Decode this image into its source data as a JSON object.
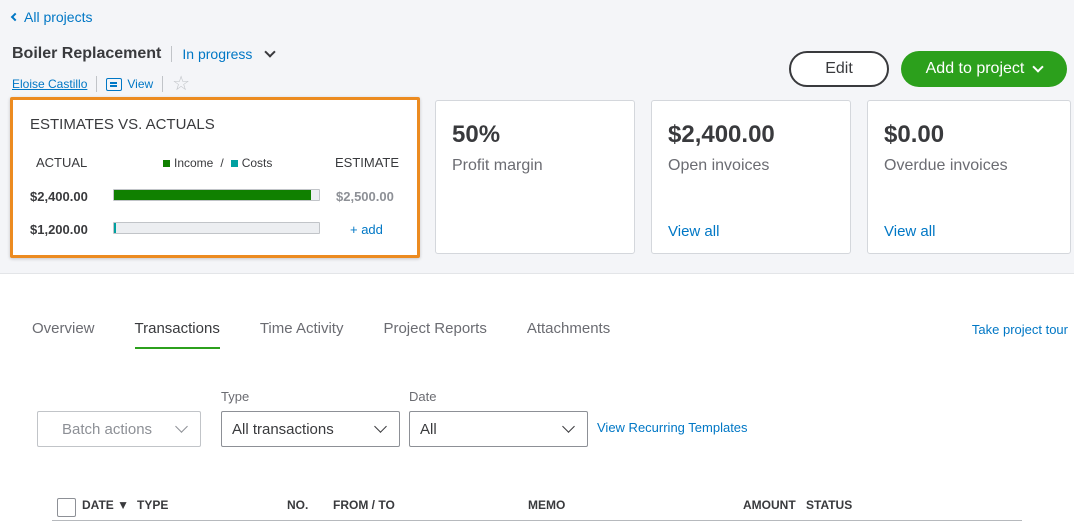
{
  "nav": {
    "back_label": "All projects"
  },
  "project": {
    "title": "Boiler Replacement",
    "status": "In progress",
    "customer": "Eloise Castillo",
    "view_label": "View"
  },
  "actions": {
    "edit_label": "Edit",
    "add_label": "Add to project"
  },
  "estimates": {
    "title": "ESTIMATES VS. ACTUALS",
    "actual_label": "ACTUAL",
    "legend_income": "Income",
    "legend_slash": "/",
    "legend_costs": "Costs",
    "estimate_label": "ESTIMATE",
    "income_actual": "$2,400.00",
    "income_estimate": "$2,500.00",
    "income_progress": 0.96,
    "cost_actual": "$1,200.00",
    "cost_progress": 0.01,
    "add_label": "+ add",
    "income_color": "#108000",
    "cost_color": "#00a0a0"
  },
  "cards": [
    {
      "value": "50%",
      "label": "Profit margin"
    },
    {
      "value": "$2,400.00",
      "label": "Open invoices",
      "link": "View all"
    },
    {
      "value": "$0.00",
      "label": "Overdue invoices",
      "link": "View all"
    }
  ],
  "tabs": [
    "Overview",
    "Transactions",
    "Time Activity",
    "Project Reports",
    "Attachments"
  ],
  "active_tab": "Transactions",
  "tour_label": "Take project tour",
  "filters": {
    "batch_label": "Batch actions",
    "type_label": "Type",
    "type_value": "All transactions",
    "date_label": "Date",
    "date_value": "All",
    "recurring_label": "View Recurring Templates"
  },
  "table": {
    "headers": [
      "DATE ▼",
      "TYPE",
      "NO.",
      "FROM / TO",
      "MEMO",
      "AMOUNT",
      "STATUS"
    ]
  }
}
